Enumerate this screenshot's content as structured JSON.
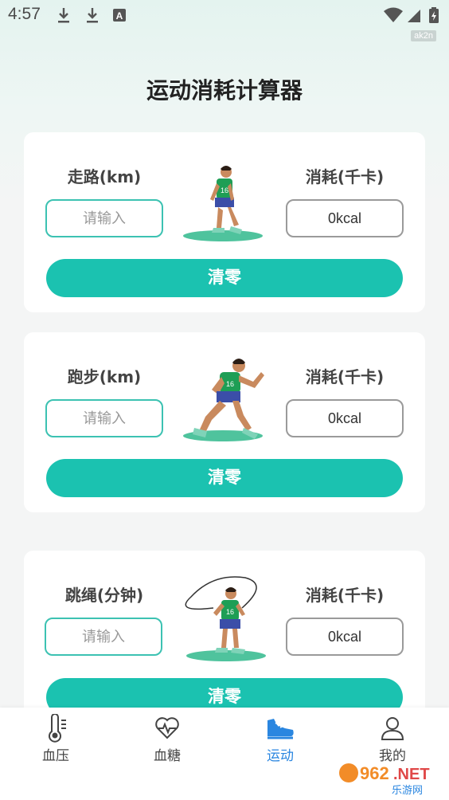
{
  "status_bar": {
    "time": "4:57",
    "tag": "ak2n"
  },
  "page": {
    "title": "运动消耗计算器"
  },
  "cards": [
    {
      "activity_label": "走路(km)",
      "input_placeholder": "请输入",
      "result_label": "消耗(千卡)",
      "result_value": "0kcal",
      "clear_label": "清零"
    },
    {
      "activity_label": "跑步(km)",
      "input_placeholder": "请输入",
      "result_label": "消耗(千卡)",
      "result_value": "0kcal",
      "clear_label": "清零"
    },
    {
      "activity_label": "跳绳(分钟)",
      "input_placeholder": "请输入",
      "result_label": "消耗(千卡)",
      "result_value": "0kcal",
      "clear_label": "清零"
    }
  ],
  "bottom_nav": {
    "items": [
      {
        "label": "血压",
        "icon": "thermometer-icon",
        "active": false
      },
      {
        "label": "血糖",
        "icon": "heart-pulse-icon",
        "active": false
      },
      {
        "label": "运动",
        "icon": "sneaker-icon",
        "active": true
      },
      {
        "label": "我的",
        "icon": "person-icon",
        "active": false
      }
    ]
  },
  "watermark": {
    "brand": "962.NET",
    "sub": "乐游网"
  },
  "colors": {
    "accent": "#1bc2b0",
    "active_nav": "#2a86e0",
    "shirt": "#1e9e55"
  }
}
